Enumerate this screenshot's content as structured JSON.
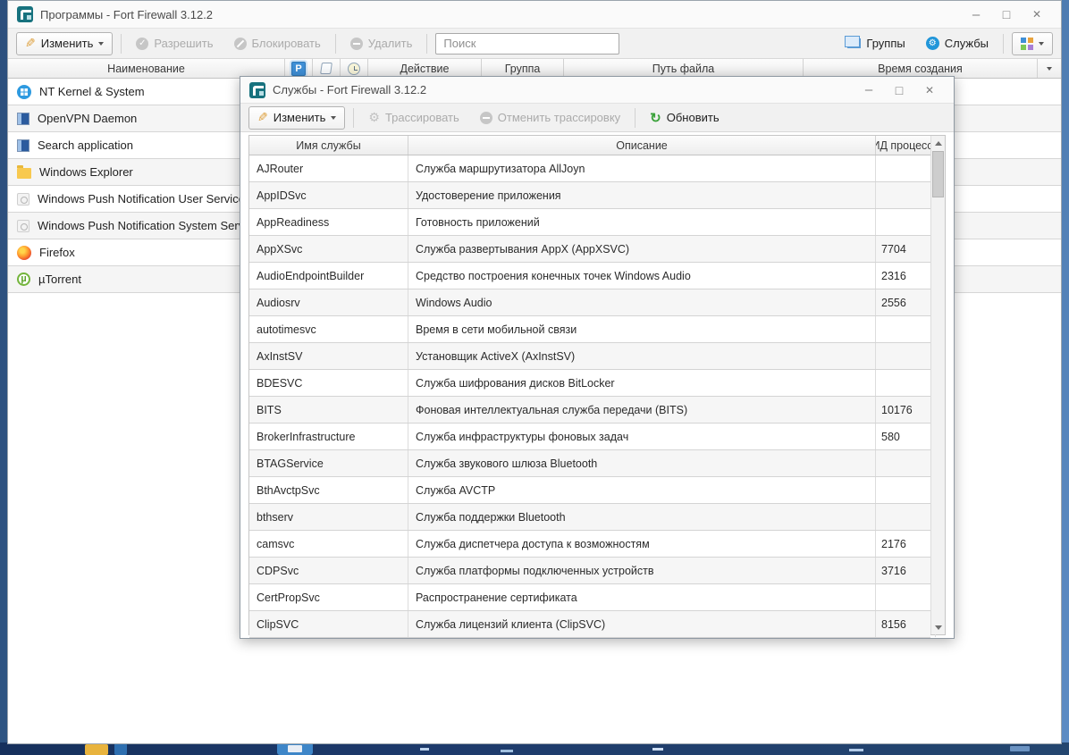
{
  "main_window": {
    "title": "Программы - Fort Firewall 3.12.2",
    "toolbar": {
      "edit_label": "Изменить",
      "allow_label": "Разрешить",
      "block_label": "Блокировать",
      "remove_label": "Удалить",
      "search_placeholder": "Поиск",
      "groups_label": "Группы",
      "services_label": "Службы"
    },
    "table": {
      "header": {
        "name": "Наименование",
        "parental_badge": "P",
        "action": "Действие",
        "group": "Группа",
        "path": "Путь файла",
        "created": "Время создания"
      },
      "programs": [
        {
          "name": "NT Kernel & System",
          "icon": "windows"
        },
        {
          "name": "OpenVPN Daemon",
          "icon": "app-blue"
        },
        {
          "name": "Search application",
          "icon": "app-blue"
        },
        {
          "name": "Windows Explorer",
          "icon": "folder"
        },
        {
          "name": "Windows Push Notification User Service",
          "icon": "gray-app"
        },
        {
          "name": "Windows Push Notification System Service",
          "icon": "gray-app"
        },
        {
          "name": "Firefox",
          "icon": "firefox"
        },
        {
          "name": "µTorrent",
          "icon": "utorrent"
        }
      ]
    }
  },
  "dialog": {
    "title": "Службы - Fort Firewall 3.12.2",
    "toolbar": {
      "edit_label": "Изменить",
      "trace_label": "Трассировать",
      "cancel_trace_label": "Отменить трассировку",
      "refresh_label": "Обновить"
    },
    "table": {
      "header": {
        "name": "Имя службы",
        "description": "Описание",
        "pid": "ИД процесса"
      },
      "rows": [
        {
          "name": "AJRouter",
          "description": "Служба маршрутизатора AllJoyn",
          "pid": ""
        },
        {
          "name": "AppIDSvc",
          "description": "Удостоверение приложения",
          "pid": ""
        },
        {
          "name": "AppReadiness",
          "description": "Готовность приложений",
          "pid": ""
        },
        {
          "name": "AppXSvc",
          "description": "Служба развертывания AppX (AppXSVC)",
          "pid": "7704"
        },
        {
          "name": "AudioEndpointBuilder",
          "description": "Средство построения конечных точек Windows Audio",
          "pid": "2316"
        },
        {
          "name": "Audiosrv",
          "description": "Windows Audio",
          "pid": "2556"
        },
        {
          "name": "autotimesvc",
          "description": "Время в сети мобильной связи",
          "pid": ""
        },
        {
          "name": "AxInstSV",
          "description": "Установщик ActiveX (AxInstSV)",
          "pid": ""
        },
        {
          "name": "BDESVC",
          "description": "Служба шифрования дисков BitLocker",
          "pid": ""
        },
        {
          "name": "BITS",
          "description": "Фоновая интеллектуальная служба передачи (BITS)",
          "pid": "10176"
        },
        {
          "name": "BrokerInfrastructure",
          "description": "Служба инфраструктуры фоновых задач",
          "pid": "580"
        },
        {
          "name": "BTAGService",
          "description": "Служба звукового шлюза Bluetooth",
          "pid": ""
        },
        {
          "name": "BthAvctpSvc",
          "description": "Служба AVCTP",
          "pid": ""
        },
        {
          "name": "bthserv",
          "description": "Служба поддержки Bluetooth",
          "pid": ""
        },
        {
          "name": "camsvc",
          "description": "Служба диспетчера доступа к возможностям",
          "pid": "2176"
        },
        {
          "name": "CDPSvc",
          "description": "Служба платформы подключенных устройств",
          "pid": "3716"
        },
        {
          "name": "CertPropSvc",
          "description": "Распространение сертификата",
          "pid": ""
        },
        {
          "name": "ClipSVC",
          "description": "Служба лицензий клиента (ClipSVC)",
          "pid": "8156"
        }
      ]
    }
  },
  "colors": {
    "accent_blue": "#3f8fd6",
    "logo_teal": "#17727e",
    "refresh_green": "#3ba23b",
    "pencil_orange": "#dd9f3d",
    "disabled_gray": "#ababab"
  }
}
